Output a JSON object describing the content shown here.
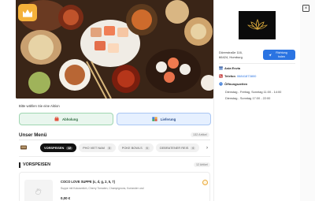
{
  "action": {
    "prompt": "Bitte wählen Sie eine Aktion",
    "pickup_label": "Abholung",
    "delivery_label": "Lieferung"
  },
  "menu": {
    "title": "Unser Menü",
    "total": "132 Artikel"
  },
  "categories": [
    {
      "label": "VORSPEISEN",
      "count": "12",
      "active": true
    },
    {
      "label": "PHO VIET NAM",
      "count": "8",
      "active": false
    },
    {
      "label": "POKE BOWLS",
      "count": "6",
      "active": false
    },
    {
      "label": "GEBRATENER REIS",
      "count": "6",
      "active": false
    }
  ],
  "section": {
    "title": "VORSPEISEN",
    "count": "12 Artikel"
  },
  "item": {
    "name": "COCO LOVE SUPPE (c, d, g, 2, 5, 7)",
    "description": "Suppe mit Kokosmilch, Cherry Tomaten, Champignons, Koriander und",
    "price": "0,00 €"
  },
  "restaurant": {
    "address_line1": "Dürerstraße 116,",
    "address_line2": "66424, Homburg",
    "route_label": "Richtung holen",
    "name": "Asia Evvia",
    "phone_key": "Telefon",
    "phone": "06841873800",
    "hours_key": "Öffnungszeiten",
    "hours": [
      "Dienstag - Freitag, Sonntag 11:00 - 14:00",
      "Dienstag - Sonntag 17:00 - 22:00"
    ]
  },
  "icons": {
    "crown": "crown-icon",
    "pickup": "bag-icon",
    "delivery": "delivery-icon",
    "category": "list-icon",
    "route": "navigation-icon",
    "close": "close-icon"
  },
  "colors": {
    "accent": "#2b74e2",
    "badge": "#f4b13a",
    "active_chip": "#111111"
  }
}
